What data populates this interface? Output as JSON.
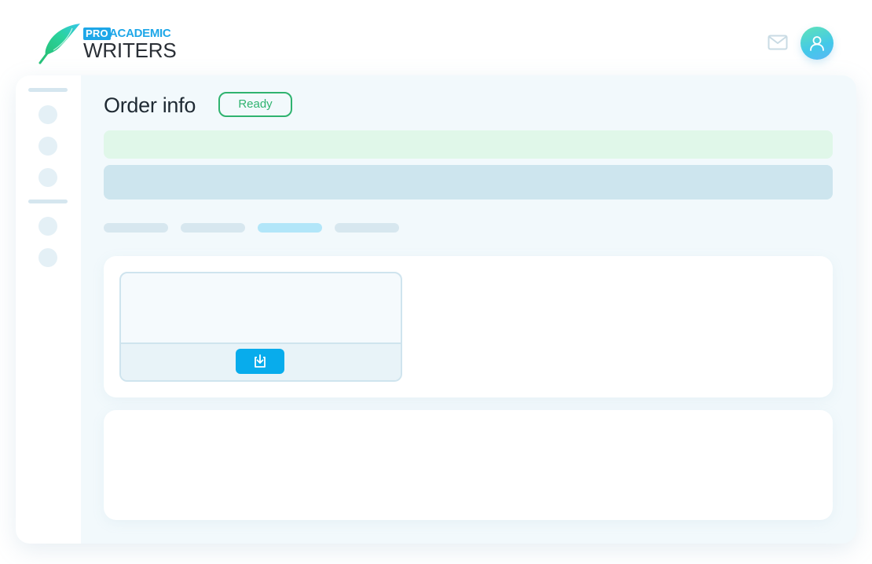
{
  "logo": {
    "badge": "PRO",
    "line1": "ACADEMIC",
    "line2": "WRITERS",
    "icon": "feather-icon",
    "brand_color": "#1ea7e8"
  },
  "header": {
    "mail_icon": "mail-icon",
    "avatar_icon": "user-icon"
  },
  "main": {
    "title": "Order info",
    "status": "Ready",
    "status_color": "#2fb36f"
  },
  "tabs": {
    "active_index": 2,
    "count": 4
  },
  "file_card": {
    "download_icon": "download-icon",
    "button_color": "#08acec"
  }
}
